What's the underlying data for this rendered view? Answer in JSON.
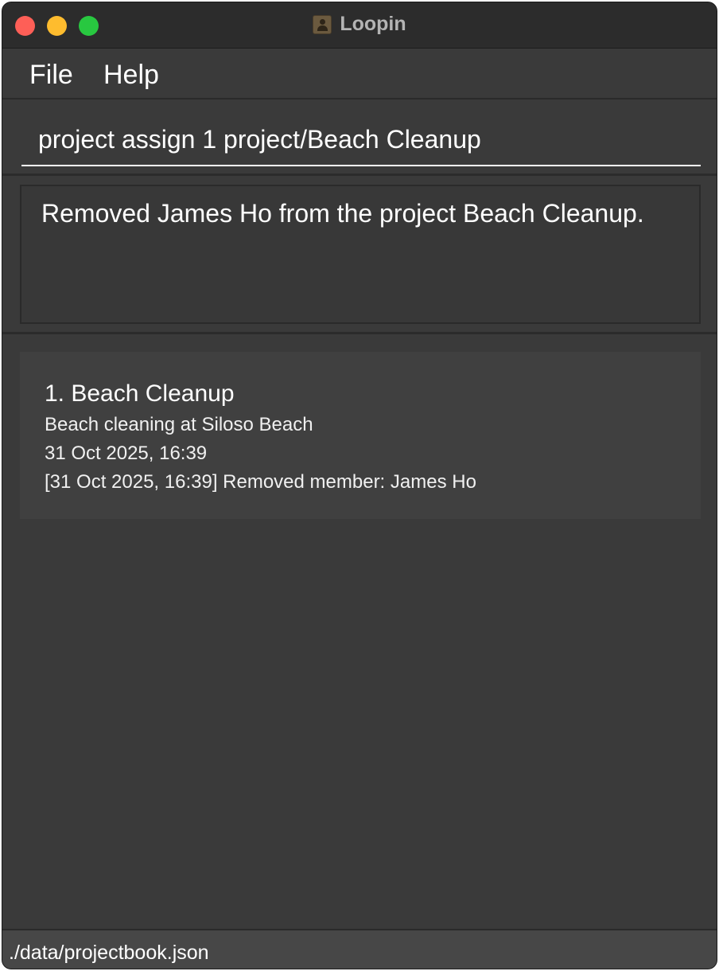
{
  "window": {
    "title": "Loopin",
    "title_icon": "address-book-icon"
  },
  "menu": {
    "items": [
      {
        "label": "File"
      },
      {
        "label": "Help"
      }
    ]
  },
  "command": {
    "value": "project assign 1 project/Beach Cleanup"
  },
  "result": {
    "message": "Removed James Ho from the project Beach Cleanup."
  },
  "projects": [
    {
      "title": "1. Beach Cleanup",
      "description": "Beach cleaning at Siloso Beach",
      "date": "31 Oct 2025, 16:39",
      "log": "[31 Oct 2025, 16:39] Removed member: James Ho"
    }
  ],
  "status": {
    "file_path": "./data/projectbook.json"
  },
  "colors": {
    "background": "#3a3a3a",
    "card": "#404040",
    "text": "#ffffff",
    "close": "#fe5f57",
    "minimize": "#febc2e",
    "maximize": "#28c840"
  }
}
